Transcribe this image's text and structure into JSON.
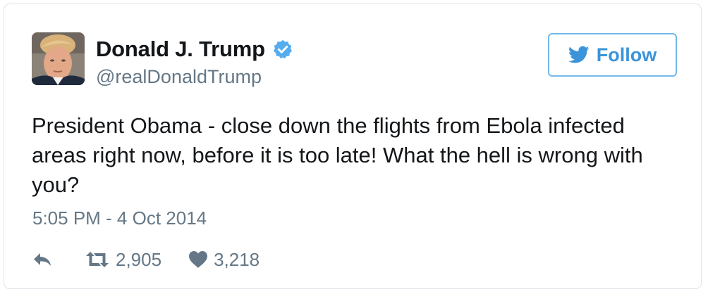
{
  "user": {
    "display_name": "Donald J. Trump",
    "handle": "@realDonaldTrump",
    "verified": true
  },
  "follow_button": {
    "label": "Follow"
  },
  "tweet": {
    "text": "President Obama - close down the flights from Ebola infected areas right now, before it is too late! What the hell is wrong with you?",
    "timestamp": "5:05 PM - 4 Oct 2014"
  },
  "actions": {
    "reply_icon": "reply-icon",
    "retweet_icon": "retweet-icon",
    "like_icon": "heart-icon",
    "retweets": "2,905",
    "likes": "3,218"
  },
  "colors": {
    "accent": "#3b94d9",
    "follow_border": "#73b8ea",
    "text": "#14171a",
    "muted": "#657786",
    "verified": "#55acee"
  }
}
